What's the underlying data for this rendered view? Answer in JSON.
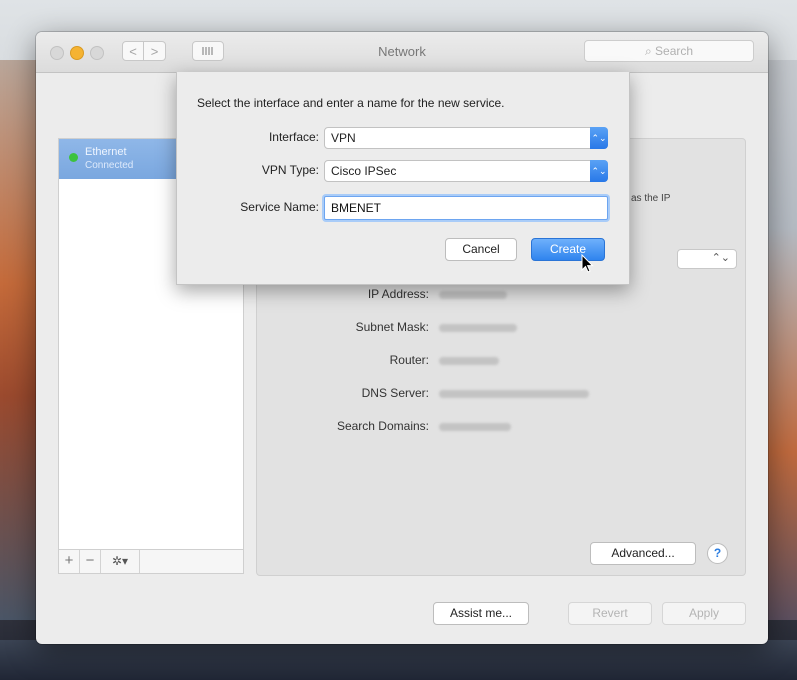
{
  "window": {
    "title": "Network",
    "search_placeholder": "Search",
    "nav": {
      "back": "<",
      "forward": ">"
    }
  },
  "sidebar": {
    "services": [
      {
        "name": "Ethernet",
        "status": "Connected",
        "status_color": "#3cc23e"
      }
    ],
    "toolbar": {
      "add": "+",
      "remove": "−",
      "gear": "✲▾"
    }
  },
  "main": {
    "partial_text": "as the IP",
    "fields": [
      {
        "label": "IP Address:"
      },
      {
        "label": "Subnet Mask:"
      },
      {
        "label": "Router:"
      },
      {
        "label": "DNS Server:"
      },
      {
        "label": "Search Domains:"
      }
    ],
    "advanced_button": "Advanced...",
    "help_button": "?"
  },
  "footer": {
    "assist": "Assist me...",
    "revert": "Revert",
    "apply": "Apply"
  },
  "sheet": {
    "message": "Select the interface and enter a name for the new service.",
    "interface_label": "Interface:",
    "interface_value": "VPN",
    "vpn_type_label": "VPN Type:",
    "vpn_type_value": "Cisco IPSec",
    "service_name_label": "Service Name:",
    "service_name_value": "BMENET",
    "cancel": "Cancel",
    "create": "Create"
  },
  "colors": {
    "accent": "#2f84ee",
    "selected_row": "#7aa7df",
    "connected": "#3cc23e"
  }
}
